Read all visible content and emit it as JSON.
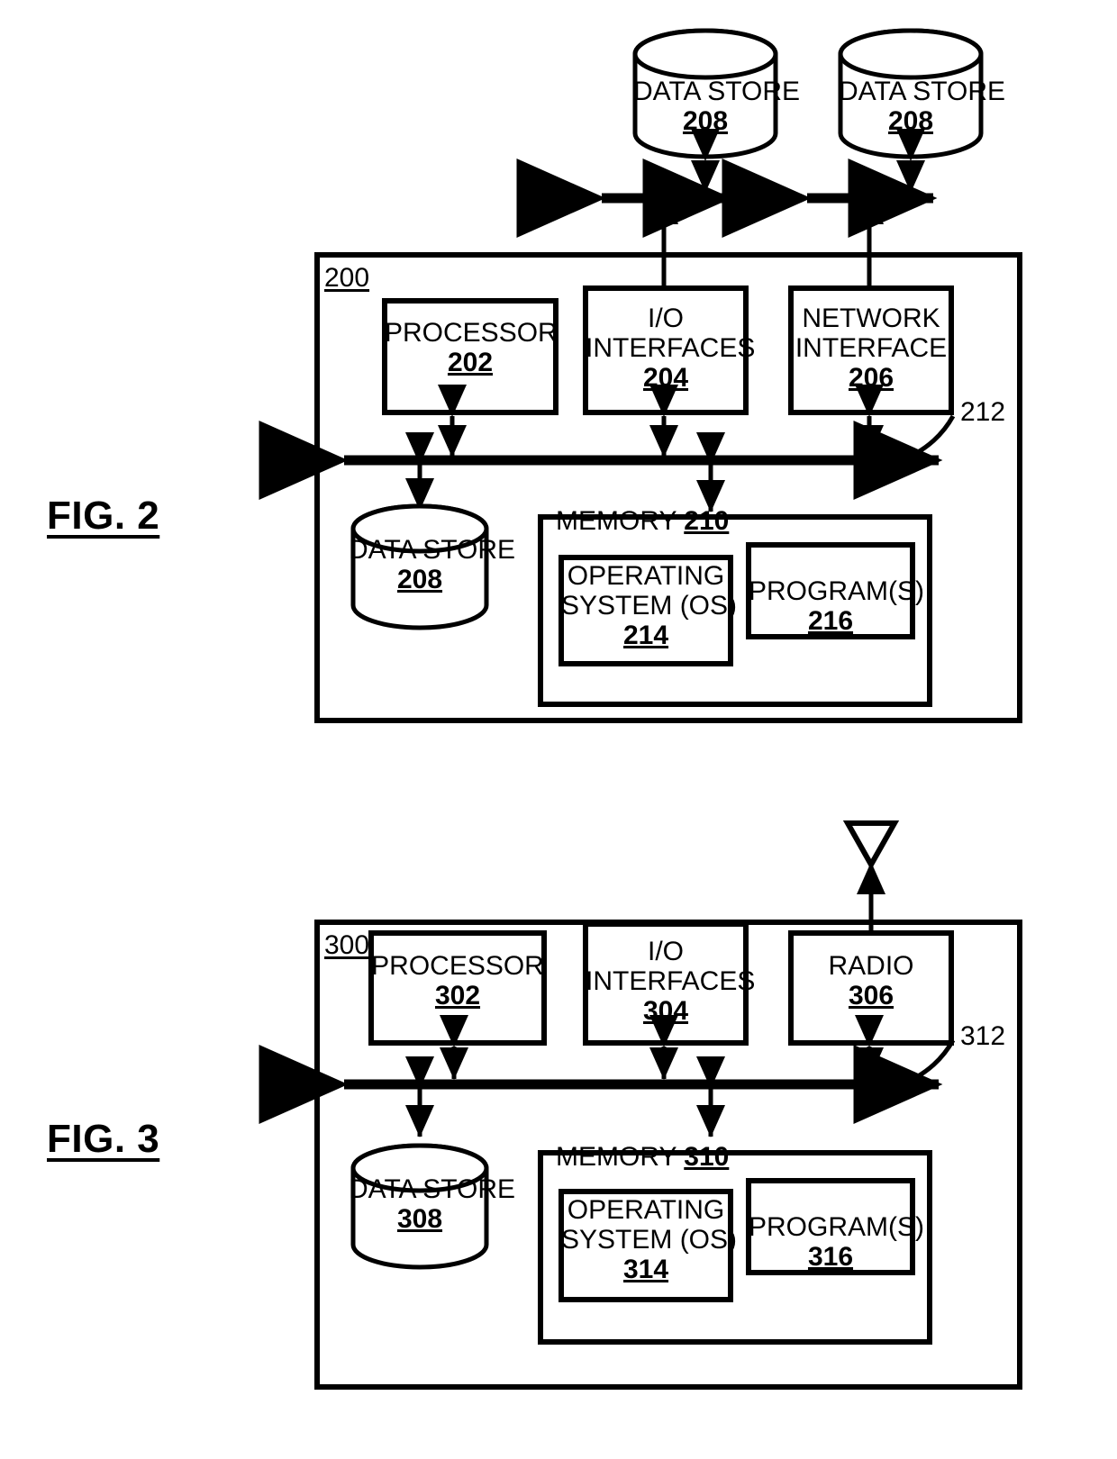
{
  "figures": [
    {
      "id": "fig2",
      "label": "FIG. 2",
      "system_ref": "200",
      "bus_ref": "212",
      "external_stores": [
        {
          "title": "DATA STORE",
          "ref": "208"
        },
        {
          "title": "DATA STORE",
          "ref": "208"
        }
      ],
      "top_blocks": [
        {
          "name": "processor",
          "lines": [
            "PROCESSOR"
          ],
          "ref": "202"
        },
        {
          "name": "io-interfaces",
          "lines": [
            "I/O",
            "INTERFACES"
          ],
          "ref": "204"
        },
        {
          "name": "network-interface",
          "lines": [
            "NETWORK",
            "INTERFACE"
          ],
          "ref": "206"
        }
      ],
      "internal_store": {
        "title": "DATA STORE",
        "ref": "208"
      },
      "memory": {
        "title": "MEMORY",
        "ref": "210",
        "children": [
          {
            "name": "operating-system",
            "lines": [
              "OPERATING",
              "SYSTEM (OS)"
            ],
            "ref": "214"
          },
          {
            "name": "programs",
            "lines": [
              "PROGRAM(S)"
            ],
            "ref": "216"
          }
        ]
      }
    },
    {
      "id": "fig3",
      "label": "FIG. 3",
      "system_ref": "300",
      "bus_ref": "312",
      "antenna": "antenna-icon",
      "top_blocks": [
        {
          "name": "processor",
          "lines": [
            "PROCESSOR"
          ],
          "ref": "302"
        },
        {
          "name": "io-interfaces",
          "lines": [
            "I/O",
            "INTERFACES"
          ],
          "ref": "304"
        },
        {
          "name": "radio",
          "lines": [
            "RADIO"
          ],
          "ref": "306"
        }
      ],
      "internal_store": {
        "title": "DATA STORE",
        "ref": "308"
      },
      "memory": {
        "title": "MEMORY",
        "ref": "310",
        "children": [
          {
            "name": "operating-system",
            "lines": [
              "OPERATING",
              "SYSTEM (OS)"
            ],
            "ref": "314"
          },
          {
            "name": "programs",
            "lines": [
              "PROGRAM(S)"
            ],
            "ref": "316"
          }
        ]
      }
    }
  ],
  "colors": {
    "ink": "#000000",
    "paper": "#ffffff"
  }
}
